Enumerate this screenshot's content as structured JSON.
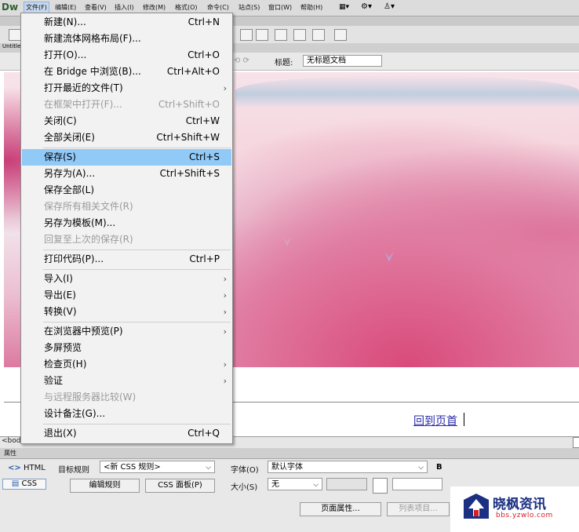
{
  "menubar": {
    "logo": "Dw",
    "items": [
      "文件(F)",
      "编辑(E)",
      "查看(V)",
      "插入(I)",
      "修改(M)",
      "格式(O)",
      "命令(C)",
      "站点(S)",
      "窗口(W)",
      "帮助(H)"
    ]
  },
  "doc": {
    "title_label": "标题:",
    "title_value": "无标题文档",
    "back_to_top": "回到页首",
    "tag_selector": "<bod"
  },
  "file_menu": {
    "items": [
      {
        "label": "新建(N)...",
        "shortcut": "Ctrl+N"
      },
      {
        "label": "新建流体网格布局(F)...",
        "shortcut": ""
      },
      {
        "label": "打开(O)...",
        "shortcut": "Ctrl+O"
      },
      {
        "label": "在 Bridge 中浏览(B)...",
        "shortcut": "Ctrl+Alt+O"
      },
      {
        "label": "打开最近的文件(T)",
        "shortcut": ""
      },
      {
        "label": "在框架中打开(F)...",
        "shortcut": "Ctrl+Shift+O"
      },
      {
        "label": "关闭(C)",
        "shortcut": "Ctrl+W"
      },
      {
        "label": "全部关闭(E)",
        "shortcut": "Ctrl+Shift+W"
      },
      {
        "label": "保存(S)",
        "shortcut": "Ctrl+S"
      },
      {
        "label": "另存为(A)...",
        "shortcut": "Ctrl+Shift+S"
      },
      {
        "label": "保存全部(L)",
        "shortcut": ""
      },
      {
        "label": "保存所有相关文件(R)",
        "shortcut": ""
      },
      {
        "label": "另存为模板(M)...",
        "shortcut": ""
      },
      {
        "label": "回复至上次的保存(R)",
        "shortcut": ""
      },
      {
        "label": "打印代码(P)...",
        "shortcut": "Ctrl+P"
      },
      {
        "label": "导入(I)",
        "shortcut": ""
      },
      {
        "label": "导出(E)",
        "shortcut": ""
      },
      {
        "label": "转换(V)",
        "shortcut": ""
      },
      {
        "label": "在浏览器中预览(P)",
        "shortcut": ""
      },
      {
        "label": "多屏预览",
        "shortcut": ""
      },
      {
        "label": "检查页(H)",
        "shortcut": ""
      },
      {
        "label": "验证",
        "shortcut": ""
      },
      {
        "label": "与远程服务器比较(W)",
        "shortcut": ""
      },
      {
        "label": "设计备注(G)...",
        "shortcut": ""
      },
      {
        "label": "退出(X)",
        "shortcut": "Ctrl+Q"
      }
    ],
    "submenu_arrow": "›"
  },
  "properties": {
    "panel_title": "属性",
    "html_label": "HTML",
    "css_label": "CSS",
    "target_rule_label": "目标规则",
    "target_rule_value": "<新 CSS 规则>",
    "edit_rule_button": "编辑规则",
    "css_panel_button": "CSS 面板(P)",
    "font_label": "字体(O)",
    "font_value": "默认字体",
    "bold_label": "B",
    "size_label": "大小(S)",
    "size_value": "无",
    "page_props_button": "页面属性...",
    "list_item_button": "列表项目..."
  },
  "watermark": {
    "title": "晓枫资讯",
    "url": "bbs.yzwlo.com"
  },
  "colors": {
    "menu_highlight": "#91c9f7",
    "link": "#2a2aa8",
    "watermark_blue": "#1b2f83",
    "watermark_red": "#d71f26"
  }
}
